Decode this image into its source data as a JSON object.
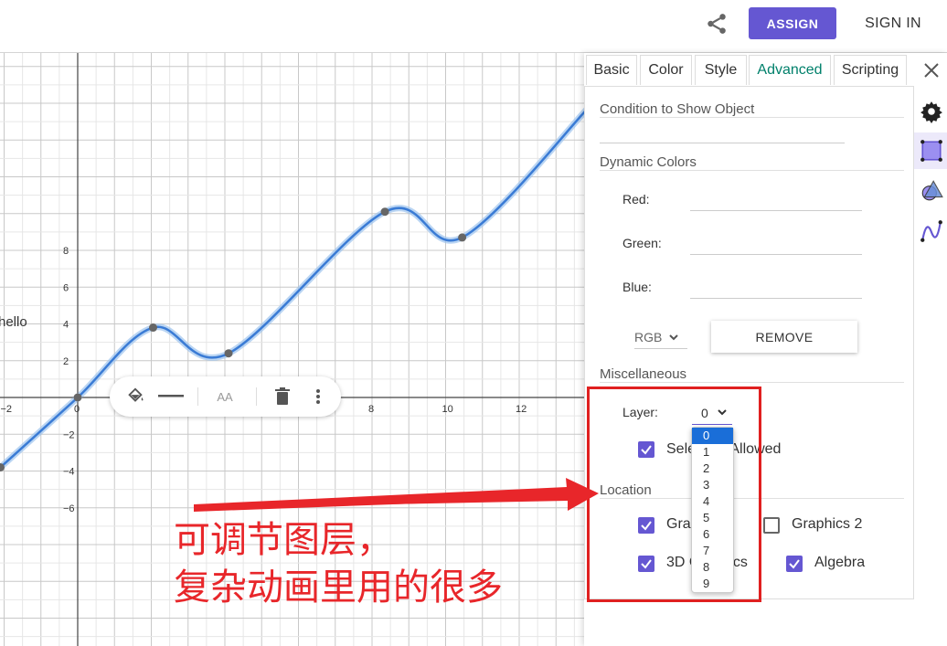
{
  "header": {
    "share_icon": "share-icon",
    "assign_label": "ASSIGN",
    "signin_label": "SIGN IN"
  },
  "graph": {
    "y_ticks": [
      "8",
      "6",
      "4",
      "2",
      "−2",
      "−4",
      "−6"
    ],
    "x_ticks": [
      "−2",
      "0",
      "8",
      "10",
      "12"
    ],
    "text_label": "hello"
  },
  "stylebar": {
    "icons": [
      "paint-bucket-icon",
      "line-style-icon",
      "text-size-icon",
      "delete-icon",
      "more-vert-icon"
    ],
    "text_size_glyph": "AA"
  },
  "panel": {
    "tabs": [
      "Basic",
      "Color",
      "Style",
      "Advanced",
      "Scripting"
    ],
    "active_tab": "Advanced",
    "condition_label": "Condition to Show Object",
    "dynamic_colors_label": "Dynamic Colors",
    "red_label": "Red:",
    "green_label": "Green:",
    "blue_label": "Blue:",
    "color_mode": "RGB",
    "remove_label": "REMOVE",
    "misc_label": "Miscellaneous",
    "layer_label": "Layer:",
    "layer_value": "0",
    "layer_options": [
      "0",
      "1",
      "2",
      "3",
      "4",
      "5",
      "6",
      "7",
      "8",
      "9"
    ],
    "selection_allowed_label": "Selection Allowed",
    "location_label": "Location",
    "graphics_label": "Graphics",
    "graphics2_label": "Graphics 2",
    "graphics3d_label": "3D Graphics",
    "algebra_label": "Algebra"
  },
  "side_icons": [
    "gear-icon",
    "object-properties-icon",
    "geometry-shapes-icon",
    "function-graph-icon"
  ],
  "annotation": {
    "line1": "可调节图层，",
    "line2": "复杂动画里用的很多"
  },
  "colors": {
    "accent": "#6557d2",
    "tab_active": "#00806b",
    "curve": "#1565c0",
    "annotation": "#e8262a"
  }
}
